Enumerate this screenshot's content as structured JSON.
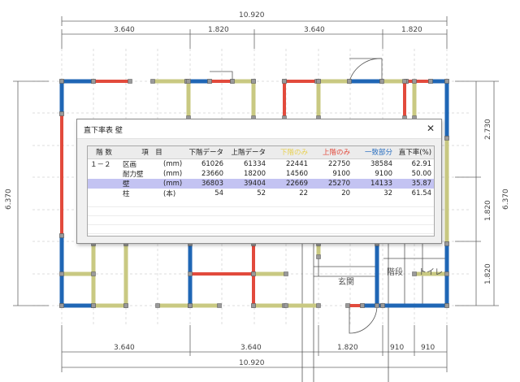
{
  "dimensions": {
    "top_total": "10.920",
    "top_segments": [
      "3.640",
      "1.820",
      "3.640",
      "1.820"
    ],
    "bottom_segments": [
      "3.640",
      "3.640",
      "1.820",
      "910",
      "910"
    ],
    "bottom_total": "10.920",
    "left_total": "6.370",
    "right_segments": [
      "2.730",
      "1.820",
      "1.820"
    ],
    "right_total": "6.370"
  },
  "rooms": {
    "entrance": "玄関",
    "stairs": "階段",
    "toilet": "トイレ"
  },
  "dialog": {
    "title": "直下率表  壁",
    "close_glyph": "✕",
    "headers": {
      "floor": "階 数",
      "item": "項　目",
      "lower": "下階データ",
      "upper": "上階データ",
      "lower_only": "下階のみ",
      "upper_only": "上階のみ",
      "match": "一致部分",
      "rate": "直下率(%)"
    },
    "rows": [
      {
        "floor": "１－２",
        "item": "区画",
        "unit": "(mm)",
        "lower": "61026",
        "upper": "61334",
        "lower_only": "22441",
        "upper_only": "22750",
        "match": "38584",
        "rate": "62.91"
      },
      {
        "floor": "",
        "item": "耐力壁",
        "unit": "(mm)",
        "lower": "23660",
        "upper": "18200",
        "lower_only": "14560",
        "upper_only": "9100",
        "match": "9100",
        "rate": "50.00"
      },
      {
        "floor": "",
        "item": "壁",
        "unit": "(mm)",
        "lower": "36803",
        "upper": "39404",
        "lower_only": "22669",
        "upper_only": "25270",
        "match": "14133",
        "rate": "35.87"
      },
      {
        "floor": "",
        "item": "柱",
        "unit": "(本)",
        "lower": "54",
        "upper": "52",
        "lower_only": "22",
        "upper_only": "20",
        "match": "32",
        "rate": "61.54"
      }
    ]
  },
  "colors": {
    "wall_red": "#e24a3c",
    "wall_blue": "#1f66b5",
    "wall_yellow": "#d6d690",
    "grid": "#dedede"
  }
}
